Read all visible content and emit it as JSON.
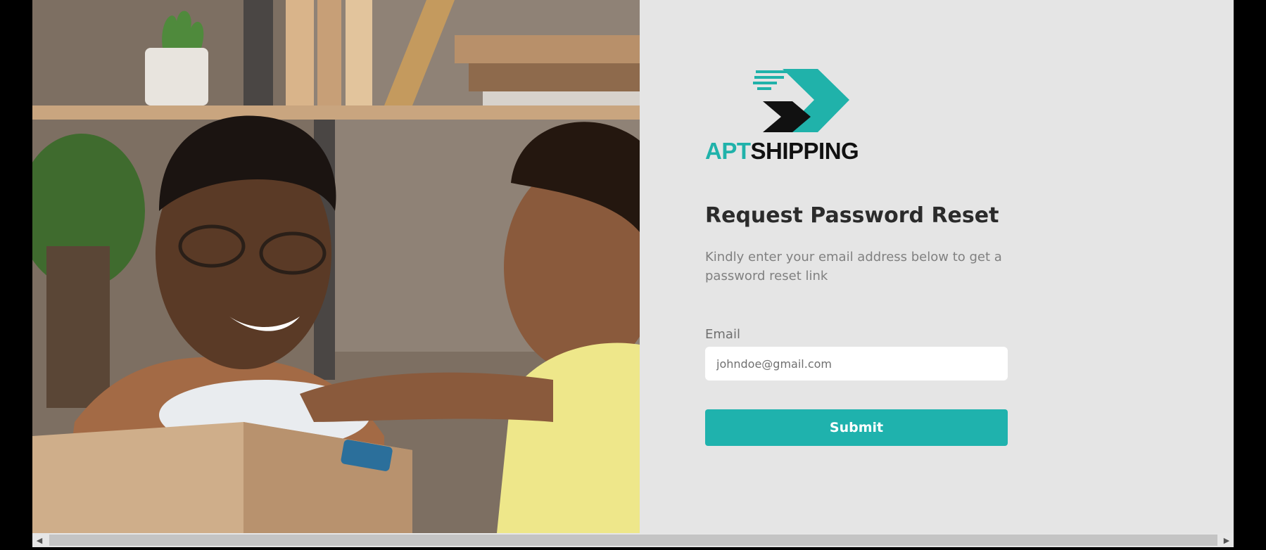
{
  "brand": {
    "logo_part1": "APT",
    "logo_part2": "SHIPPING",
    "accent_color": "#20b2aa",
    "dark_color": "#111111"
  },
  "form": {
    "title": "Request Password Reset",
    "subtitle": "Kindly enter your email address below to get a password reset link",
    "email_label": "Email",
    "email_placeholder": "johndoe@gmail.com",
    "submit_label": "Submit"
  },
  "hero": {
    "icon": "photo-man-and-child-packing-box"
  },
  "scrollbar": {
    "left_arrow": "◀",
    "right_arrow": "▶"
  }
}
